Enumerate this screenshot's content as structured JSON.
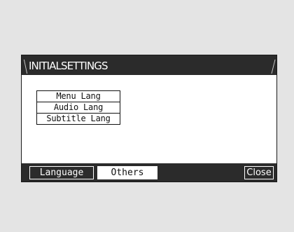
{
  "window": {
    "title": "INITIALSETTINGS"
  },
  "menu": {
    "items": [
      "Menu  Lang",
      "Audio Lang",
      "Subtitle Lang"
    ]
  },
  "tabs": {
    "language": "Language",
    "others": "Others",
    "active": "Language"
  },
  "actions": {
    "close_label": "Close"
  },
  "colors": {
    "background": "#e4e4e4",
    "bar": "#2b2b2b",
    "panel": "#ffffff",
    "text_dark": "#111111",
    "text_light": "#ffffff"
  }
}
